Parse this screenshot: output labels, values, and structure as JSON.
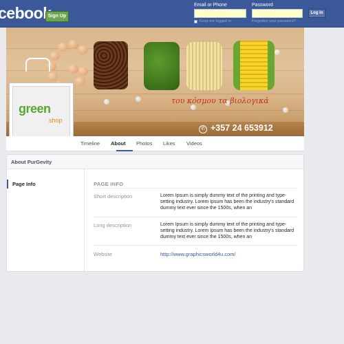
{
  "topbar": {
    "brand": "cebook",
    "signup_label": "Sign Up",
    "email_label": "Email or Phone",
    "password_label": "Password",
    "login_label": "Log In",
    "keep_logged_in": "Keep me logged in",
    "forgot_password": "Forgotten your password?",
    "colors": {
      "bar": "#3b5998",
      "signup": "#69a74e"
    }
  },
  "cover": {
    "tagline": "του κόσμου τα βιολογικά",
    "phone": "+357 24 653912",
    "icons": [
      "eggs-letter-g",
      "coffee-letter-r",
      "leaf-letter-e",
      "pasta-letter-e",
      "corn-letter-n",
      "phone-icon"
    ]
  },
  "profile": {
    "logo_text": "green",
    "logo_sub": "shop",
    "colors": {
      "green": "#5aa632",
      "orange": "#e48a1a"
    }
  },
  "tabs": [
    {
      "label": "Timeline",
      "active": false
    },
    {
      "label": "About",
      "active": true
    },
    {
      "label": "Photos",
      "active": false
    },
    {
      "label": "Likes",
      "active": false
    },
    {
      "label": "Videos",
      "active": false
    }
  ],
  "about": {
    "title": "About PurGevity",
    "side_items": [
      {
        "label": "Page Info",
        "active": true
      }
    ],
    "section_heading": "PAGE INFO",
    "rows": [
      {
        "label": "Short description",
        "value": "Lorem Ipsum is simply dummy text of the printing and type-setting industry. Lorem Ipsum has been the industry's standard dummy text ever since the 1500s, when an"
      },
      {
        "label": "Long description",
        "value": "Lorem Ipsum is simply dummy text of the printing and type-setting industry. Lorem Ipsum has been the industry's standard dummy text ever since the 1500s, when an"
      },
      {
        "label": "Website",
        "value": "http://www.graphicsworld4u.com/"
      }
    ]
  }
}
